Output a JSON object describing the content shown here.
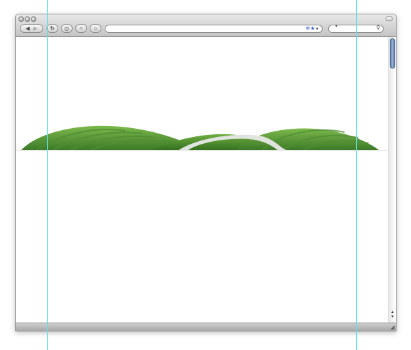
{
  "toolbar": {
    "back_icon": "chevron-left-icon",
    "forward_icon": "chevron-right-icon",
    "reload_icon": "reload-icon",
    "history_icon": "clock-icon",
    "stop_icon": "close-icon",
    "home_icon": "home-icon"
  },
  "address_bar": {
    "value": "",
    "icons": [
      "rss-icon",
      "star-icon",
      "dropdown-icon"
    ]
  },
  "search_bar": {
    "value": "",
    "icon": "search-icon"
  },
  "colors": {
    "hill_dark": "#3f7f2a",
    "hill_light": "#79b548",
    "guide": "#5fe0ea",
    "scroll_thumb": "#6d88b8"
  }
}
